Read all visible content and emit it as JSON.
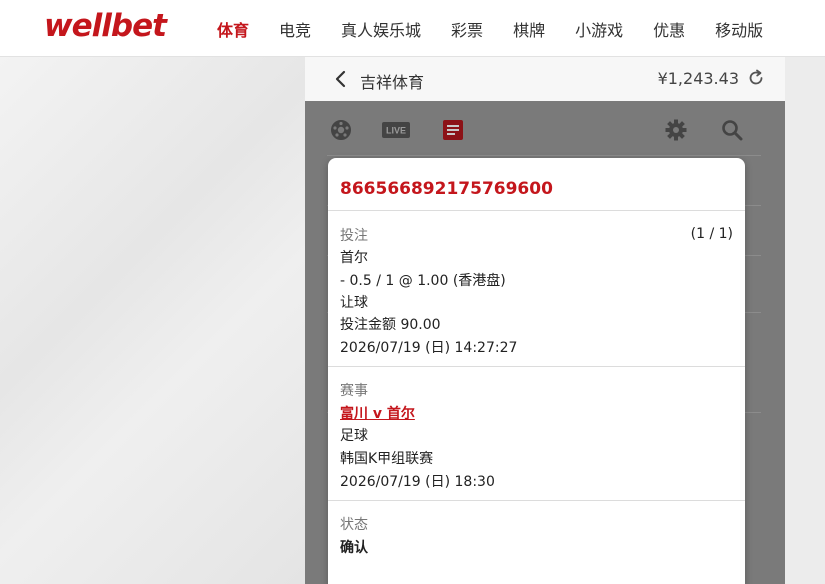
{
  "logo": "wellbet",
  "nav": [
    "体育",
    "电竞",
    "真人娱乐城",
    "彩票",
    "棋牌",
    "小游戏",
    "优惠",
    "移动版"
  ],
  "header": {
    "title": "吉祥体育",
    "balance": "¥1,243.43"
  },
  "toolbar": {
    "live_label": "LIVE"
  },
  "bet": {
    "ticket_id": "866566892175769600",
    "bet_section_label": "投注",
    "count": "(1 / 1)",
    "selection": "首尔",
    "odds_line": "- 0.5 / 1 @ 1.00 (香港盘)",
    "market": "让球",
    "stake_line": "投注金额 90.00",
    "bet_time": "2026/07/19 (日) 14:27:27",
    "event_section_label": "赛事",
    "match": "富川 v 首尔",
    "sport": "足球",
    "league": "韩国K甲组联赛",
    "match_time": "2026/07/19 (日) 18:30",
    "status_section_label": "状态",
    "status": "确认"
  },
  "colors": {
    "brand": "#c4161c",
    "overlay": "#7a7a7a"
  }
}
